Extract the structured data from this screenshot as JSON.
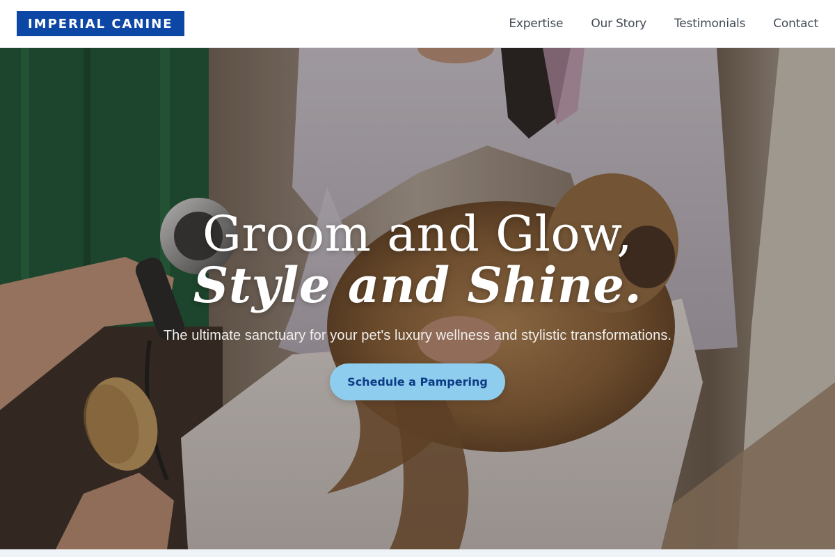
{
  "brand": {
    "name": "IMPERIAL CANINE",
    "color": "#0c47a6"
  },
  "nav": {
    "items": [
      {
        "label": "Expertise"
      },
      {
        "label": "Our Story"
      },
      {
        "label": "Testimonials"
      },
      {
        "label": "Contact"
      }
    ]
  },
  "hero": {
    "title_line1": "Groom and Glow,",
    "title_line2": "Style and Shine.",
    "subtitle": "The ultimate sanctuary for your pet's luxury wellness and stylistic transformations.",
    "cta_label": "Schedule a Pampering",
    "cta_color": "#8fcdee",
    "image_description_icon": "dog-grooming-photo"
  }
}
